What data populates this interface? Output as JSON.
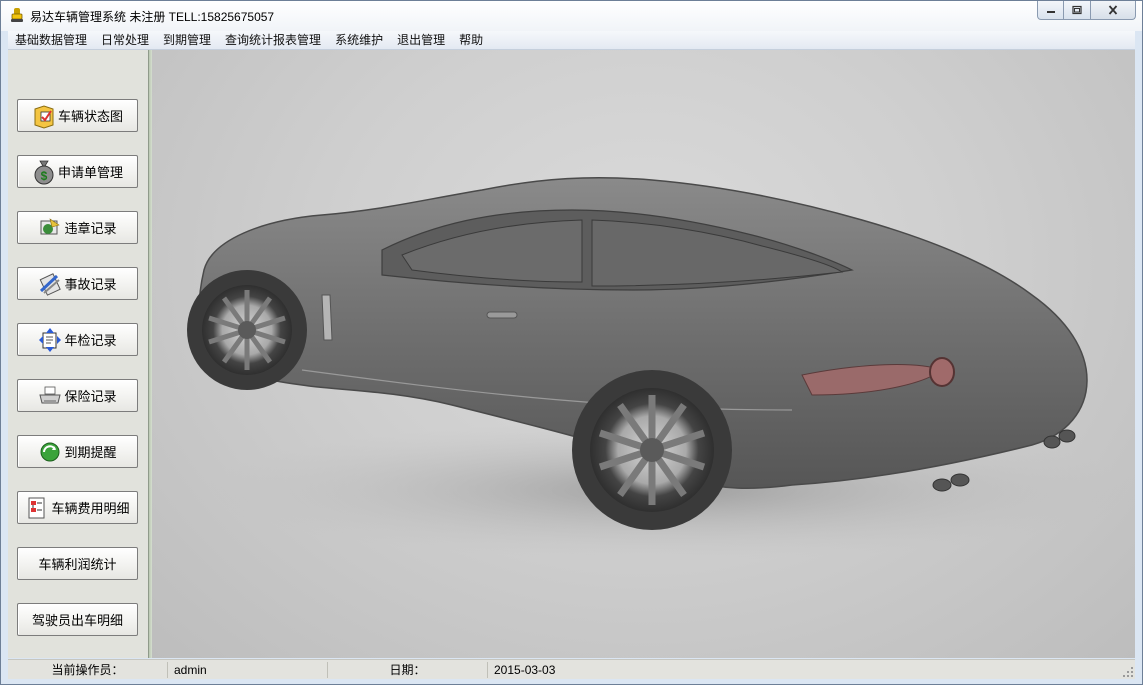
{
  "window": {
    "title": "易达车辆管理系统 未注册 TELL:15825675057"
  },
  "menu": [
    {
      "label": "基础数据管理"
    },
    {
      "label": "日常处理"
    },
    {
      "label": "到期管理"
    },
    {
      "label": "查询统计报表管理"
    },
    {
      "label": "系统维护"
    },
    {
      "label": "退出管理"
    },
    {
      "label": "帮助"
    }
  ],
  "sidebar": {
    "buttons": [
      {
        "label": "车辆状态图",
        "icon": "vehicle-status-icon"
      },
      {
        "label": "申请单管理",
        "icon": "money-bag-icon"
      },
      {
        "label": "违章记录",
        "icon": "violation-icon"
      },
      {
        "label": "事故记录",
        "icon": "accident-icon"
      },
      {
        "label": "年检记录",
        "icon": "inspection-icon"
      },
      {
        "label": "保险记录",
        "icon": "printer-icon"
      },
      {
        "label": "到期提醒",
        "icon": "reminder-icon"
      },
      {
        "label": "车辆费用明细",
        "icon": "cost-detail-icon"
      },
      {
        "label": "车辆利润统计",
        "icon": ""
      },
      {
        "label": "驾驶员出车明细",
        "icon": ""
      }
    ]
  },
  "status": {
    "operator_label": "当前操作员：",
    "operator_value": "admin",
    "date_label": "日期：",
    "date_value": "2015-03-03"
  },
  "colors": {
    "sidebar_bg": "#e1e2dc",
    "canvas_bg": "#cfcfcf",
    "titlebar_border": "#6d7f97"
  }
}
